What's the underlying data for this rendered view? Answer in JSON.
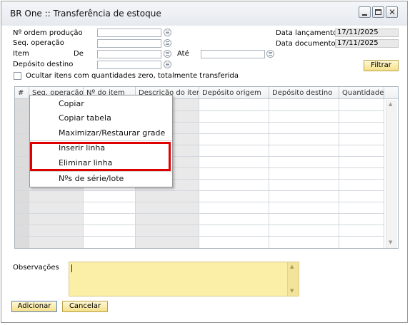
{
  "window": {
    "title": "BR One :: Transferência de estoque"
  },
  "form": {
    "ordem_label": "Nº ordem produção",
    "seq_label": "Seq. operação",
    "item_label": "Item",
    "de_label": "De",
    "ate_label": "Até",
    "deposito_label": "Depósito destino",
    "data_lancamento_label": "Data lançamento",
    "data_lancamento_value": "17/11/2025",
    "data_documento_label": "Data documento",
    "data_documento_value": "17/11/2025",
    "filtrar_label": "Filtrar",
    "ocultar_label": "Ocultar itens com quantidades zero, totalmente transferida"
  },
  "grid": {
    "columns": [
      "#",
      "Seq. operação",
      "Nº do item",
      "Descrição do item",
      "Depósito origem",
      "Depósito destino",
      "Quantidade"
    ]
  },
  "context_menu": {
    "items": [
      "Copiar",
      "Copiar tabela",
      "Maximizar/Restaurar grade",
      "Inserir linha",
      "Eliminar linha",
      "Nºs de série/lote"
    ]
  },
  "observacoes_label": "Observações",
  "buttons": {
    "adicionar": "Adicionar",
    "cancelar": "Cancelar"
  },
  "colors": {
    "accent_yellow": "#fbeea6",
    "highlight": "#e00000"
  }
}
